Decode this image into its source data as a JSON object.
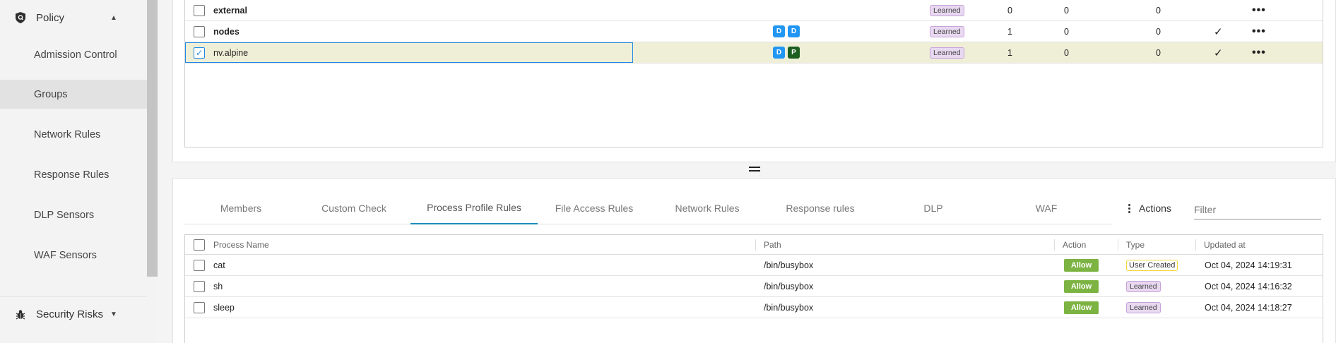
{
  "sidebar": {
    "policy_label": "Policy",
    "items": [
      {
        "label": "Admission Control"
      },
      {
        "label": "Groups"
      },
      {
        "label": "Network Rules"
      },
      {
        "label": "Response Rules"
      },
      {
        "label": "DLP Sensors"
      },
      {
        "label": "WAF Sensors"
      }
    ],
    "security_risks_label": "Security Risks"
  },
  "groups_table": {
    "rows": [
      {
        "name": "external",
        "badges": [],
        "policy": "Learned",
        "c1": "0",
        "c2": "0",
        "c3": "0",
        "check": false
      },
      {
        "name": "nodes",
        "badges": [
          "D",
          "D"
        ],
        "policy": "Learned",
        "c1": "1",
        "c2": "0",
        "c3": "0",
        "check": true
      },
      {
        "name": "nv.alpine",
        "badges": [
          "D",
          "P"
        ],
        "policy": "Learned",
        "c1": "1",
        "c2": "0",
        "c3": "0",
        "check": true
      }
    ]
  },
  "tabs": {
    "members": "Members",
    "custom_check": "Custom Check",
    "process_profile_rules": "Process Profile Rules",
    "file_access_rules": "File Access Rules",
    "network_rules": "Network Rules",
    "response_rules": "Response rules",
    "dlp": "DLP",
    "waf": "WAF"
  },
  "actions_label": "Actions",
  "filter_placeholder": "Filter",
  "process_table": {
    "headers": {
      "process_name": "Process Name",
      "path": "Path",
      "action": "Action",
      "type": "Type",
      "updated_at": "Updated at"
    },
    "rows": [
      {
        "name": "cat",
        "path": "/bin/busybox",
        "action": "Allow",
        "type": "User Created",
        "updated": "Oct 04, 2024 14:19:31"
      },
      {
        "name": "sh",
        "path": "/bin/busybox",
        "action": "Allow",
        "type": "Learned",
        "updated": "Oct 04, 2024 14:16:32"
      },
      {
        "name": "sleep",
        "path": "/bin/busybox",
        "action": "Allow",
        "type": "Learned",
        "updated": "Oct 04, 2024 14:18:27"
      }
    ]
  }
}
